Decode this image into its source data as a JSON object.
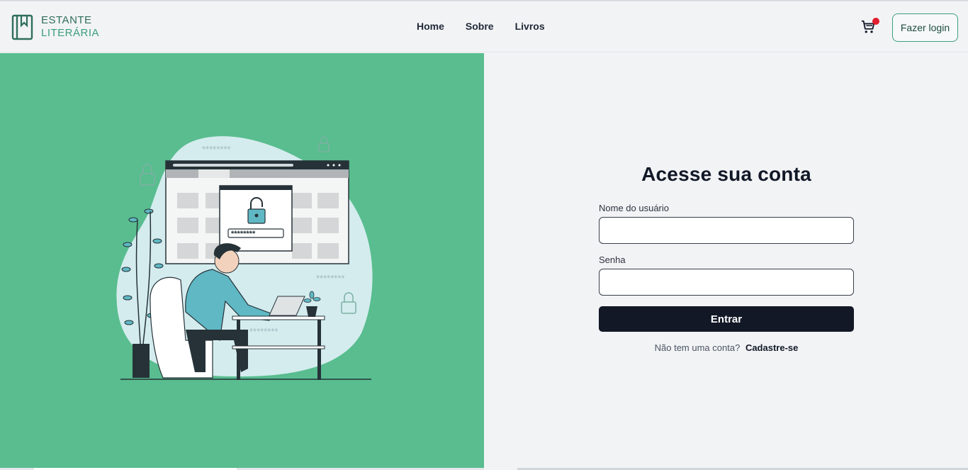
{
  "brand": {
    "line1": "ESTANTE",
    "line2": "LITERÁRIA"
  },
  "nav": {
    "items": [
      "Home",
      "Sobre",
      "Livros"
    ]
  },
  "header": {
    "cart_icon": "cart-icon",
    "cart_badge_color": "#e11d2e",
    "login_label": "Fazer login"
  },
  "hero": {
    "illustration": "person-login-illustration",
    "background": "#59bd8f"
  },
  "form": {
    "title": "Acesse sua conta",
    "username_label": "Nome do usuário",
    "username_value": "",
    "password_label": "Senha",
    "password_value": "",
    "submit_label": "Entrar",
    "signup_prompt": "Não tem uma conta?",
    "signup_link": "Cadastre-se"
  },
  "colors": {
    "accent": "#3aa07b",
    "primary_button": "#131827"
  }
}
